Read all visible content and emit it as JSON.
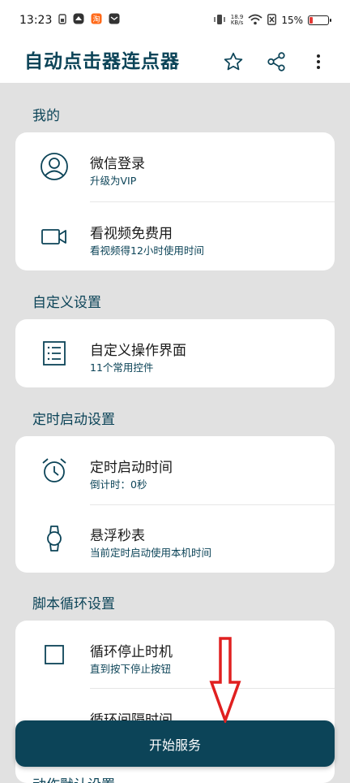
{
  "status_bar": {
    "time": "13:23",
    "net_rate_value": "18.9",
    "net_rate_unit": "KB/s",
    "battery_percent": "15%",
    "battery_level": 0.15,
    "notification_icons": [
      "sim-icon",
      "app-icon",
      "shop-icon",
      "mail-icon"
    ]
  },
  "app_bar": {
    "title": "自动点击器连点器",
    "actions": [
      "star-icon",
      "share-icon",
      "more-vert-icon"
    ]
  },
  "sections": {
    "mine": {
      "title": "我的",
      "items": [
        {
          "title": "微信登录",
          "subtitle": "升级为VIP",
          "icon": "user-avatar-icon"
        },
        {
          "title": "看视频免费用",
          "subtitle": "看视频得12小时使用时间",
          "icon": "video-camera-icon"
        }
      ]
    },
    "custom": {
      "title": "自定义设置",
      "items": [
        {
          "title": "自定义操作界面",
          "subtitle": "11个常用控件",
          "icon": "list-icon"
        }
      ]
    },
    "timer": {
      "title": "定时启动设置",
      "items": [
        {
          "title": "定时启动时间",
          "subtitle": "倒计时：0秒",
          "icon": "alarm-clock-icon"
        },
        {
          "title": "悬浮秒表",
          "subtitle": "当前定时启动使用本机时间",
          "icon": "watch-icon"
        }
      ]
    },
    "loop": {
      "title": "脚本循环设置",
      "items": [
        {
          "title": "循环停止时机",
          "subtitle": "直到按下停止按钮",
          "icon": "square-icon"
        },
        {
          "title": "循环间隔时间",
          "subtitle": "",
          "icon": "interval-icon"
        }
      ]
    },
    "next_partial_title": "动作默认设置"
  },
  "start_button": {
    "label": "开始服务"
  },
  "colors": {
    "primary": "#0c4458",
    "background": "#e1e1e1",
    "card": "#ffffff",
    "arrow": "#e02020"
  }
}
